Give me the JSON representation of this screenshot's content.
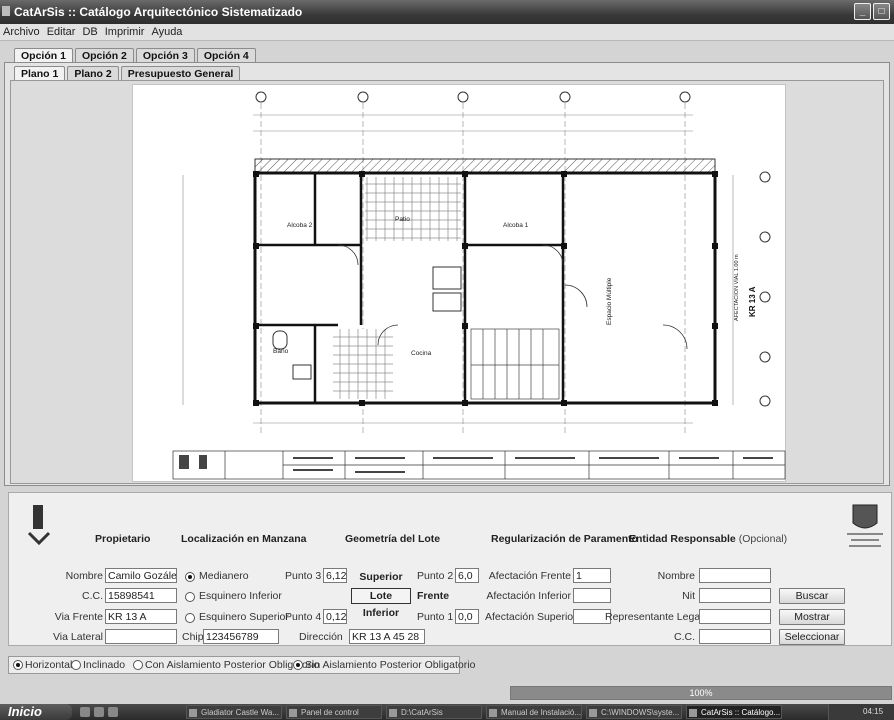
{
  "window": {
    "title": "CatArSis :: Catálogo Arquitectónico Sistematizado"
  },
  "menu": [
    "Archivo",
    "Editar",
    "DB",
    "Imprimir",
    "Ayuda"
  ],
  "option_tabs": [
    "Opción 1",
    "Opción 2",
    "Opción 3",
    "Opción 4"
  ],
  "plan_tabs": [
    "Plano 1",
    "Plano 2",
    "Presupuesto General"
  ],
  "plan": {
    "rooms": [
      "Alcoba 2",
      "Patio",
      "Alcoba 1",
      "Baño",
      "Cocina",
      "Espacio Múltiple"
    ],
    "street": "KR 13 A",
    "afectacion_label": "AFECTACION VIAL 1.00 m"
  },
  "sections": {
    "propietario": "Propietario",
    "localizacion": "Localización en Manzana",
    "geometria": "Geometría del Lote",
    "regularizacion": "Regularización de Paramento",
    "entidad": "Entidad Responsable",
    "entidad_opt": "(Opcional)"
  },
  "owner": {
    "nombre_label": "Nombre",
    "nombre": "Camilo Gozález",
    "cc_label": "C.C.",
    "cc": "15898541",
    "via_frente_label": "Via Frente",
    "via_frente": "KR 13 A",
    "via_lateral_label": "Via Lateral",
    "via_lateral": ""
  },
  "location": {
    "options": [
      "Medianero",
      "Esquinero Inferior",
      "Esquinero Superior"
    ],
    "selected": "Medianero",
    "chip_label": "Chip",
    "chip": "123456789"
  },
  "geometry": {
    "punto3_label": "Punto 3",
    "punto3": "6,12",
    "punto4_label": "Punto 4",
    "punto4": "0,12",
    "punto2_label": "Punto 2",
    "punto2": "6,0",
    "punto1_label": "Punto 1",
    "punto1": "0,0",
    "superior": "Superior",
    "lote": "Lote",
    "inferior": "Inferior",
    "frente": "Frente",
    "direccion_label": "Dirección",
    "direccion": "KR 13 A 45 28"
  },
  "regularization": {
    "frente_label": "Afectación Frente",
    "frente": "1",
    "inferior_label": "Afectación Inferior",
    "inferior": "",
    "superior_label": "Afectación Superior",
    "superior": ""
  },
  "entity": {
    "nombre_label": "Nombre",
    "nombre": "",
    "nit_label": "Nit",
    "nit": "",
    "rep_label": "Representante Legal",
    "rep": "",
    "cc_label": "C.C.",
    "cc": "",
    "buscar": "Buscar",
    "mostrar": "Mostrar",
    "seleccionar": "Seleccionar"
  },
  "options_bar": {
    "horizontal": "Horizontal",
    "inclinado": "Inclinado",
    "con_aislamiento": "Con Aislamiento Posterior Obligatorio",
    "sin_aislamiento": "Sin Aislamiento Posterior Obligatorio"
  },
  "progress": {
    "value": 1.0,
    "label": "100%"
  },
  "taskbar": {
    "start": "Inicio",
    "tasks": [
      "Gladiator Castle Wa...",
      "Panel de control",
      "D:\\CatArSis",
      "Manual de Instalació...",
      "C:\\WINDOWS\\syste...",
      "CatArSis :: Catálogo..."
    ],
    "clock": "04:15"
  },
  "colors": {
    "titlebar": "#3a3a3a",
    "panel": "#efefef",
    "taskbar": "#2f2f2f"
  }
}
